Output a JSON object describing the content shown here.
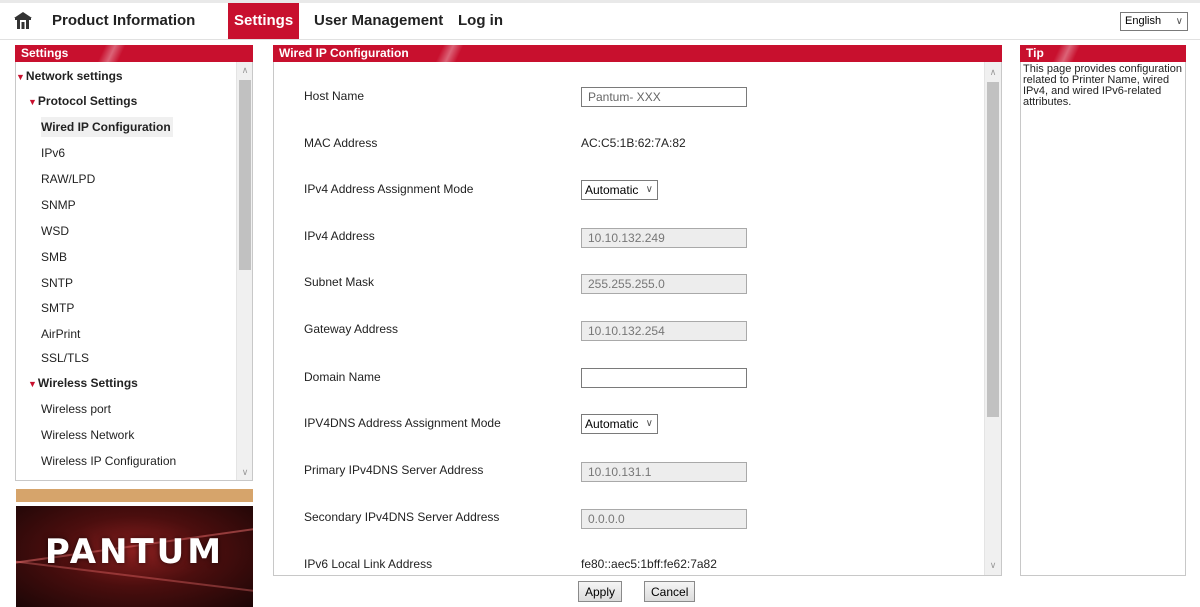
{
  "nav": {
    "items": [
      "Product Information",
      "Settings",
      "User Management",
      "Log in"
    ],
    "active": "Settings"
  },
  "language": {
    "selected": "English"
  },
  "left_panel": {
    "title": "Settings",
    "tree": [
      {
        "label": "Network settings",
        "type": "group",
        "expanded": true
      },
      {
        "label": "Protocol Settings",
        "type": "group",
        "expanded": true
      },
      {
        "label": "Wired IP Configuration",
        "type": "item",
        "selected": true
      },
      {
        "label": "IPv6",
        "type": "item"
      },
      {
        "label": "RAW/LPD",
        "type": "item"
      },
      {
        "label": "SNMP",
        "type": "item"
      },
      {
        "label": "WSD",
        "type": "item"
      },
      {
        "label": "SMB",
        "type": "item"
      },
      {
        "label": "SNTP",
        "type": "item"
      },
      {
        "label": "SMTP",
        "type": "item"
      },
      {
        "label": "AirPrint",
        "type": "item"
      },
      {
        "label": "SSL/TLS",
        "type": "item"
      },
      {
        "label": "Wireless Settings",
        "type": "group",
        "expanded": true
      },
      {
        "label": "Wireless port",
        "type": "item"
      },
      {
        "label": "Wireless Network",
        "type": "item"
      },
      {
        "label": "Wireless IP Configuration",
        "type": "item"
      }
    ]
  },
  "logo": {
    "text": "PANTUM"
  },
  "main": {
    "title": "Wired IP Configuration",
    "rows": [
      {
        "label": "Host Name",
        "kind": "input",
        "value": "Pantum- XXX"
      },
      {
        "label": "MAC Address",
        "kind": "text",
        "value": "AC:C5:1B:62:7A:82"
      },
      {
        "label": "IPv4 Address Assignment Mode",
        "kind": "select",
        "value": "Automatic"
      },
      {
        "label": "IPv4 Address",
        "kind": "disabled",
        "value": "10.10.132.249"
      },
      {
        "label": "Subnet Mask",
        "kind": "disabled",
        "value": "255.255.255.0"
      },
      {
        "label": "Gateway Address",
        "kind": "disabled",
        "value": "10.10.132.254"
      },
      {
        "label": "Domain Name",
        "kind": "input",
        "value": ""
      },
      {
        "label": "IPV4DNS Address Assignment Mode",
        "kind": "select",
        "value": "Automatic"
      },
      {
        "label": "Primary IPv4DNS Server Address",
        "kind": "disabled",
        "value": "10.10.131.1"
      },
      {
        "label": "Secondary IPv4DNS Server Address",
        "kind": "disabled",
        "value": "0.0.0.0"
      },
      {
        "label": "IPv6 Local Link Address",
        "kind": "text",
        "value": "fe80::aec5:1bff:fe62:7a82"
      }
    ]
  },
  "tip": {
    "title": "Tip",
    "text": "This page provides configuration related to Printer Name, wired IPv4, and wired IPv6-related attributes."
  },
  "buttons": {
    "apply": "Apply",
    "cancel": "Cancel"
  },
  "colors": {
    "accent": "#c8102e",
    "tan": "#d6a46b"
  },
  "icons": {
    "home": "home-icon"
  }
}
